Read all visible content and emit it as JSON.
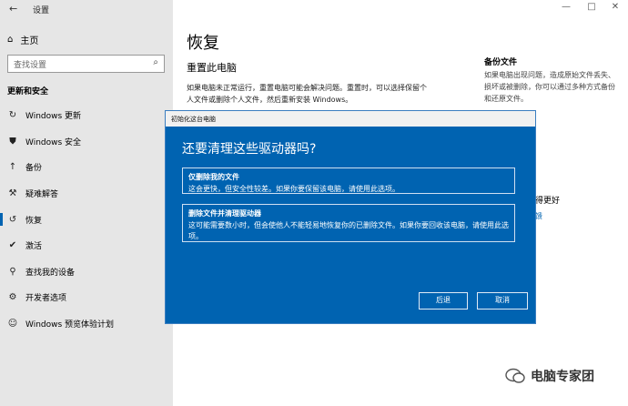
{
  "window": {
    "title": "设置",
    "back_glyph": "←",
    "min_glyph": "—",
    "max_glyph": "□",
    "close_glyph": "✕"
  },
  "sidebar": {
    "home_label": "主页",
    "search_placeholder": "查找设置",
    "section_label": "更新和安全",
    "items": [
      {
        "label": "Windows 更新",
        "icon": "sync-icon"
      },
      {
        "label": "Windows 安全",
        "icon": "shield-icon"
      },
      {
        "label": "备份",
        "icon": "upload-icon"
      },
      {
        "label": "疑难解答",
        "icon": "wrench-icon"
      },
      {
        "label": "恢复",
        "icon": "history-icon"
      },
      {
        "label": "激活",
        "icon": "check-circle-icon"
      },
      {
        "label": "查找我的设备",
        "icon": "person-locate-icon"
      },
      {
        "label": "开发者选项",
        "icon": "tools-icon"
      },
      {
        "label": "Windows 预览体验计划",
        "icon": "smiley-icon"
      }
    ],
    "active_index": 4
  },
  "main": {
    "title": "恢复",
    "reset_heading": "重置此电脑",
    "reset_desc": "如果电脑未正常运行，重置电脑可能会解决问题。重置时，可以选择保留个人文件或删除个人文件，然后重新安装 Windows。"
  },
  "right_panel": {
    "backup_title": "备份文件",
    "backup_desc": "如果电脑出现问题，造成原始文件丢失、损坏或被删除，你可以通过多种方式备份和还原文件。",
    "better_peek": "得更好",
    "link_peek": "馈"
  },
  "dialog": {
    "title": "初始化这台电脑",
    "heading": "还要清理这些驱动器吗?",
    "options": [
      {
        "title": "仅删除我的文件",
        "desc": "这会更快，但安全性较差。如果你要保留该电脑，请使用此选项。"
      },
      {
        "title": "删除文件并清理驱动器",
        "desc": "这可能需要数小时，但会使他人不能轻易地恢复你的已删除文件。如果你要回收该电脑，请使用此选项。"
      }
    ],
    "back_label": "后退",
    "cancel_label": "取消"
  },
  "watermark": {
    "text": "电脑专家团"
  },
  "colors": {
    "accent": "#0063b1",
    "sidebar_bg": "#e6e6e6"
  }
}
